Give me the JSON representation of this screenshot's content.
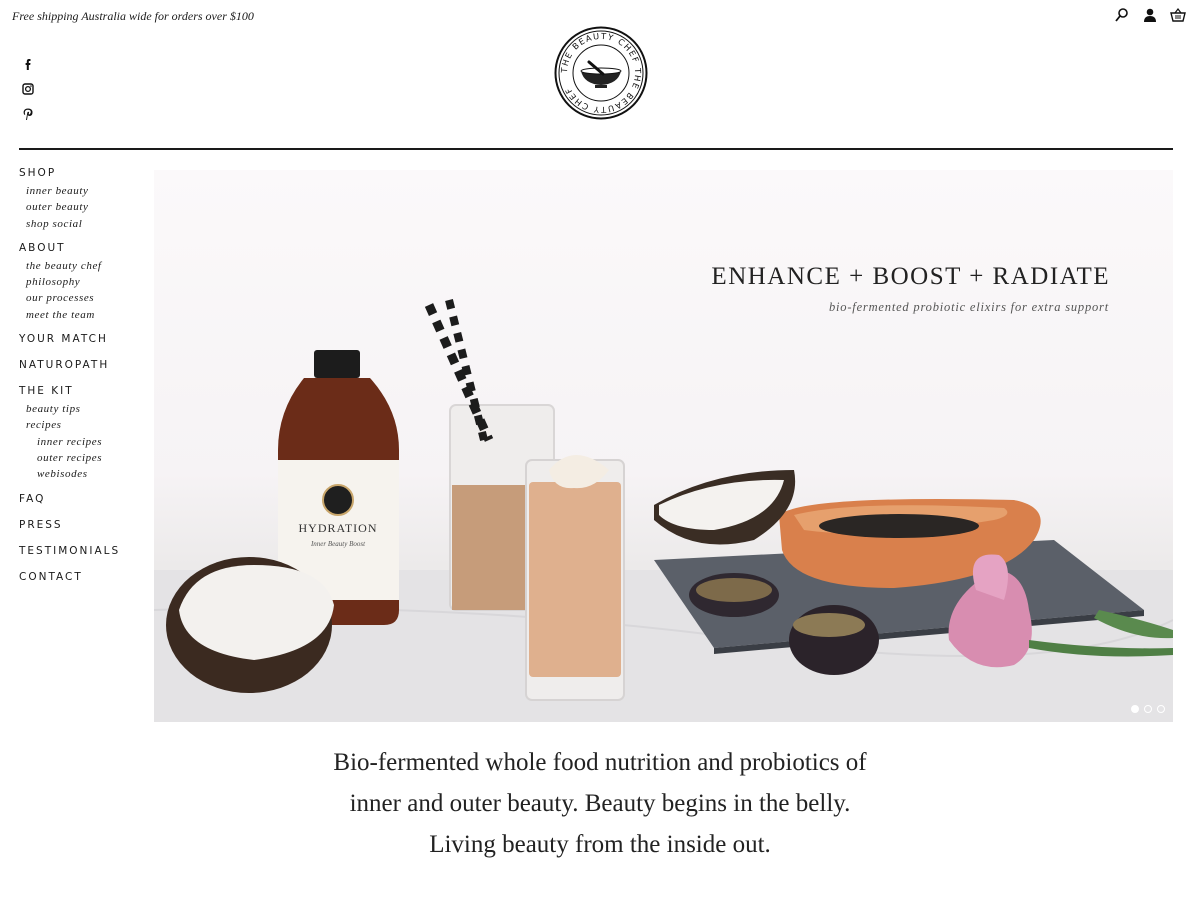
{
  "header": {
    "promo": "Free shipping Australia wide for orders over $100",
    "brand_ring_text": "THE BEAUTY CHEF THE BEAUTY CHEF",
    "icons": [
      "search-icon",
      "account-icon",
      "cart-icon"
    ],
    "social": [
      "facebook-icon",
      "instagram-icon",
      "pinterest-icon"
    ]
  },
  "nav": {
    "shop": {
      "label": "SHOP",
      "items": [
        "inner beauty",
        "outer beauty",
        "shop social"
      ]
    },
    "about": {
      "label": "ABOUT",
      "items": [
        "the beauty chef",
        "philosophy",
        "our processes",
        "meet the team"
      ]
    },
    "your_match": "YOUR MATCH",
    "naturopath": "NATUROPATH",
    "the_kit": {
      "label": "THE KIT",
      "items": [
        "beauty tips",
        "recipes"
      ],
      "recipes_items": [
        "inner recipes",
        "outer recipes",
        "webisodes"
      ]
    },
    "faq": "FAQ",
    "press": "PRESS",
    "testimonials": "TESTIMONIALS",
    "contact": "CONTACT"
  },
  "hero": {
    "title": "ENHANCE + BOOST + RADIATE",
    "subtitle": "bio-fermented probiotic elixirs for extra support",
    "bottle_label_title": "HYDRATION",
    "bottle_label_sub": "Inner Beauty Boost",
    "slides_total": 3,
    "slide_active": 1
  },
  "tagline": {
    "line1": "Bio-fermented whole food nutrition and probiotics of",
    "line2": "inner and outer beauty. Beauty begins in the belly.",
    "line3": "Living beauty from the inside out."
  },
  "colors": {
    "text": "#1a1a1a",
    "background": "#ffffff"
  }
}
